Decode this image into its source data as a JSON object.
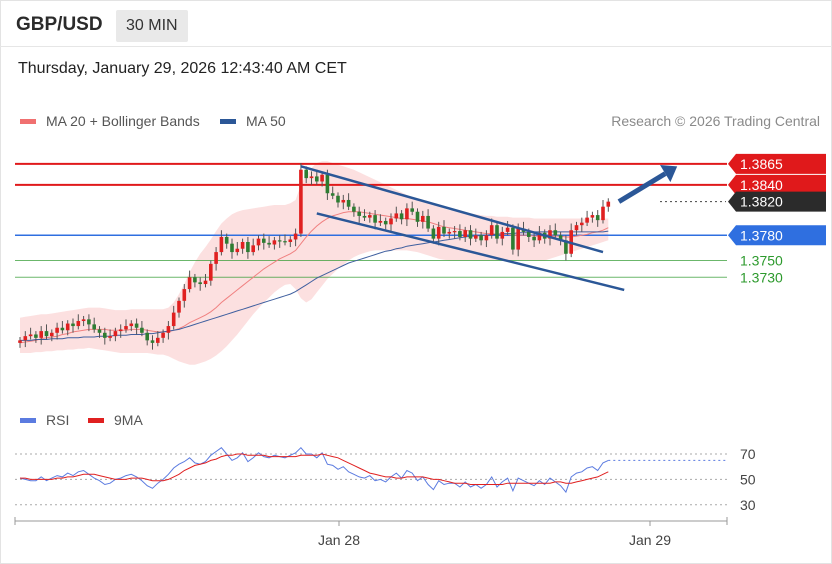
{
  "header": {
    "pair": "GBP/USD",
    "timeframe": "30 MIN",
    "datetime": "Thursday, January 29, 2026 12:43:40 AM CET"
  },
  "legend": {
    "ma_bb": "MA 20 + Bollinger Bands",
    "ma50": "MA 50",
    "rsi": "RSI",
    "rsi_ma": "9MA"
  },
  "credit": "Research © 2026 Trading Central",
  "colors": {
    "resistance": "#e0191b",
    "pivot": "#2f6fe0",
    "support": "#2d9a2d",
    "channel": "#2b5797",
    "bollinger_fill": "#fbd5d5",
    "ma20": "#f08080",
    "ma50": "#3f5f9f",
    "bull": "#e02020",
    "bear": "#2e7d32",
    "current": "#2b2b2b"
  },
  "chart_data": [
    {
      "type": "candlestick",
      "title": "GBP/USD 30 MIN",
      "x_ticks": [
        "Jan 28",
        "Jan 29"
      ],
      "ylim": [
        1.359,
        1.3885
      ],
      "levels": [
        {
          "value": 1.3865,
          "label": "1.3865",
          "kind": "resistance"
        },
        {
          "value": 1.384,
          "label": "1.3840",
          "kind": "resistance"
        },
        {
          "value": 1.382,
          "label": "1.3820",
          "kind": "current"
        },
        {
          "value": 1.378,
          "label": "1.3780",
          "kind": "pivot"
        },
        {
          "value": 1.375,
          "label": "1.3750",
          "kind": "support"
        },
        {
          "value": 1.373,
          "label": "1.3730",
          "kind": "support"
        }
      ],
      "close": [
        1.3655,
        1.366,
        1.3662,
        1.3658,
        1.3666,
        1.366,
        1.3664,
        1.367,
        1.3667,
        1.3675,
        1.3672,
        1.3678,
        1.368,
        1.3674,
        1.3668,
        1.3664,
        1.3658,
        1.366,
        1.3666,
        1.3668,
        1.3672,
        1.3675,
        1.367,
        1.3664,
        1.3655,
        1.3652,
        1.3658,
        1.3664,
        1.3672,
        1.3688,
        1.3702,
        1.3716,
        1.373,
        1.3724,
        1.3722,
        1.3726,
        1.3746,
        1.376,
        1.3778,
        1.377,
        1.376,
        1.3764,
        1.3772,
        1.376,
        1.3768,
        1.3776,
        1.3771,
        1.3769,
        1.3774,
        1.3773,
        1.3772,
        1.3775,
        1.3782,
        1.3858,
        1.3848,
        1.385,
        1.3844,
        1.3852,
        1.383,
        1.3827,
        1.3819,
        1.3822,
        1.3814,
        1.3808,
        1.3803,
        1.3801,
        1.3804,
        1.3795,
        1.3797,
        1.3793,
        1.38,
        1.3806,
        1.3799,
        1.3812,
        1.3808,
        1.3796,
        1.3803,
        1.3788,
        1.3776,
        1.379,
        1.3782,
        1.3784,
        1.3785,
        1.3778,
        1.3786,
        1.3776,
        1.378,
        1.3774,
        1.378,
        1.3792,
        1.3776,
        1.3784,
        1.3789,
        1.3763,
        1.3788,
        1.3784,
        1.3778,
        1.3774,
        1.3783,
        1.3776,
        1.3786,
        1.378,
        1.3774,
        1.3758,
        1.3786,
        1.3792,
        1.3795,
        1.3801,
        1.3804,
        1.3798,
        1.3814,
        1.382
      ],
      "ma20": [
        1.3652,
        1.3653,
        1.3654,
        1.3655,
        1.3657,
        1.3658,
        1.3659,
        1.366,
        1.3662,
        1.3663,
        1.3665,
        1.3666,
        1.3667,
        1.3668,
        1.3668,
        1.3668,
        1.3668,
        1.3667,
        1.3667,
        1.3667,
        1.3667,
        1.3668,
        1.3668,
        1.3668,
        1.3667,
        1.3666,
        1.3665,
        1.3665,
        1.3665,
        1.3667,
        1.3669,
        1.3672,
        1.3676,
        1.3679,
        1.3682,
        1.3685,
        1.3689,
        1.3694,
        1.37,
        1.3705,
        1.371,
        1.3715,
        1.372,
        1.3725,
        1.373,
        1.3735,
        1.374,
        1.3744,
        1.3748,
        1.3752,
        1.3755,
        1.3758,
        1.3762,
        1.377,
        1.3778,
        1.3785,
        1.3791,
        1.3796,
        1.38,
        1.3803,
        1.3805,
        1.3807,
        1.3808,
        1.3808,
        1.3808,
        1.3807,
        1.3806,
        1.3805,
        1.3804,
        1.3803,
        1.3802,
        1.3801,
        1.38,
        1.38,
        1.3799,
        1.3798,
        1.3797,
        1.3796,
        1.3794,
        1.3792,
        1.379,
        1.3789,
        1.3788,
        1.3787,
        1.3786,
        1.3785,
        1.3784,
        1.3783,
        1.3782,
        1.3782,
        1.3781,
        1.3781,
        1.3781,
        1.378,
        1.378,
        1.378,
        1.378,
        1.3779,
        1.3779,
        1.3779,
        1.3779,
        1.3779,
        1.3779,
        1.3778,
        1.3778,
        1.3779,
        1.378,
        1.3781,
        1.3783,
        1.3784,
        1.3786,
        1.3789
      ],
      "ma50": [
        1.3655,
        1.3655,
        1.3655,
        1.3656,
        1.3656,
        1.3656,
        1.3657,
        1.3657,
        1.3657,
        1.3658,
        1.3658,
        1.3658,
        1.3659,
        1.3659,
        1.3659,
        1.366,
        1.366,
        1.366,
        1.3661,
        1.3661,
        1.3661,
        1.3662,
        1.3662,
        1.3662,
        1.3663,
        1.3663,
        1.3664,
        1.3665,
        1.3666,
        1.3667,
        1.3668,
        1.367,
        1.3672,
        1.3674,
        1.3676,
        1.3678,
        1.368,
        1.3682,
        1.3684,
        1.3686,
        1.3688,
        1.369,
        1.3692,
        1.3694,
        1.3696,
        1.3698,
        1.37,
        1.3702,
        1.3704,
        1.3706,
        1.3708,
        1.371,
        1.3713,
        1.3717,
        1.3721,
        1.3725,
        1.3729,
        1.3732,
        1.3735,
        1.3738,
        1.3741,
        1.3744,
        1.3747,
        1.3749,
        1.3751,
        1.3753,
        1.3755,
        1.3757,
        1.3759,
        1.3761,
        1.3762,
        1.3764,
        1.3765,
        1.3767,
        1.3768,
        1.3769,
        1.377,
        1.3771,
        1.3772,
        1.3773,
        1.3774,
        1.3775,
        1.3776,
        1.3777,
        1.3778,
        1.3779,
        1.3779,
        1.378,
        1.378,
        1.3781,
        1.3781,
        1.3782,
        1.3782,
        1.3782,
        1.3783,
        1.3783,
        1.3783,
        1.3784,
        1.3784,
        1.3784,
        1.3784,
        1.3784,
        1.3784,
        1.3784,
        1.3784,
        1.3784,
        1.3784,
        1.3784,
        1.3784,
        1.3784,
        1.3784,
        1.3785
      ],
      "bb_upper": [
        1.3682,
        1.3683,
        1.3684,
        1.3685,
        1.3686,
        1.3686,
        1.3687,
        1.3688,
        1.3689,
        1.369,
        1.3691,
        1.3692,
        1.3693,
        1.3694,
        1.3694,
        1.3694,
        1.3693,
        1.3692,
        1.3691,
        1.3691,
        1.3691,
        1.3692,
        1.3692,
        1.3692,
        1.3692,
        1.3692,
        1.3692,
        1.3692,
        1.3694,
        1.37,
        1.371,
        1.3722,
        1.3736,
        1.3748,
        1.3758,
        1.3766,
        1.3775,
        1.3785,
        1.3794,
        1.38,
        1.3805,
        1.3808,
        1.381,
        1.3811,
        1.3812,
        1.3813,
        1.3814,
        1.3815,
        1.3816,
        1.3816,
        1.3816,
        1.3818,
        1.3822,
        1.384,
        1.3852,
        1.386,
        1.3866,
        1.3868,
        1.3868,
        1.3866,
        1.3864,
        1.3862,
        1.386,
        1.3858,
        1.3855,
        1.3852,
        1.3849,
        1.3846,
        1.3843,
        1.384,
        1.3837,
        1.3834,
        1.3831,
        1.3828,
        1.3825,
        1.3822,
        1.382,
        1.3818,
        1.3816,
        1.3814,
        1.3812,
        1.381,
        1.3809,
        1.3808,
        1.3807,
        1.3806,
        1.3805,
        1.3804,
        1.3803,
        1.3803,
        1.3802,
        1.3802,
        1.3802,
        1.3801,
        1.3801,
        1.3801,
        1.3801,
        1.38,
        1.38,
        1.38,
        1.38,
        1.38,
        1.38,
        1.38,
        1.38,
        1.38,
        1.38,
        1.38,
        1.38,
        1.38,
        1.38,
        1.38
      ],
      "bb_lower": [
        1.364,
        1.364,
        1.364,
        1.3641,
        1.3641,
        1.3642,
        1.3642,
        1.3643,
        1.3643,
        1.3644,
        1.3644,
        1.3645,
        1.3645,
        1.3646,
        1.3645,
        1.3644,
        1.3643,
        1.3642,
        1.3641,
        1.364,
        1.364,
        1.364,
        1.364,
        1.364,
        1.364,
        1.3639,
        1.3638,
        1.3638,
        1.3636,
        1.3633,
        1.363,
        1.3628,
        1.3626,
        1.3626,
        1.3628,
        1.363,
        1.3633,
        1.3637,
        1.3642,
        1.3648,
        1.3655,
        1.3662,
        1.367,
        1.3678,
        1.3686,
        1.3693,
        1.37,
        1.3706,
        1.3712,
        1.3717,
        1.3721,
        1.3722,
        1.3716,
        1.3705,
        1.37,
        1.3704,
        1.3712,
        1.372,
        1.3728,
        1.3734,
        1.374,
        1.3745,
        1.375,
        1.3754,
        1.3757,
        1.3759,
        1.3761,
        1.3762,
        1.3762,
        1.3762,
        1.3762,
        1.3762,
        1.3762,
        1.3762,
        1.3761,
        1.376,
        1.3758,
        1.3756,
        1.3754,
        1.3752,
        1.3751,
        1.375,
        1.375,
        1.375,
        1.375,
        1.375,
        1.375,
        1.375,
        1.375,
        1.375,
        1.375,
        1.375,
        1.375,
        1.375,
        1.375,
        1.375,
        1.375,
        1.375,
        1.375,
        1.375,
        1.3752,
        1.3754,
        1.3756,
        1.3758,
        1.376,
        1.3762,
        1.3764,
        1.3766,
        1.3768,
        1.377,
        1.3772,
        1.3774
      ],
      "channel_upper": [
        {
          "bar": 53,
          "value": 1.3862
        },
        {
          "bar": 110,
          "value": 1.376
        }
      ],
      "channel_lower": [
        {
          "bar": 56,
          "value": 1.3806
        },
        {
          "bar": 114,
          "value": 1.3715
        }
      ],
      "arrow": [
        {
          "bar": 113,
          "value": 1.382
        },
        {
          "bar": 124,
          "value": 1.3862
        }
      ]
    },
    {
      "type": "line",
      "title": "RSI",
      "y_ticks": [
        70,
        50,
        30
      ],
      "ylim": [
        18,
        85
      ],
      "series": [
        {
          "name": "RSI",
          "values": [
            51,
            50,
            49,
            49,
            52,
            49,
            51,
            53,
            52,
            55,
            53,
            56,
            57,
            54,
            51,
            49,
            46,
            47,
            50,
            51,
            53,
            54,
            52,
            49,
            45,
            43,
            47,
            50,
            54,
            59,
            62,
            64,
            67,
            63,
            62,
            64,
            69,
            72,
            75,
            70,
            65,
            67,
            71,
            64,
            67,
            71,
            68,
            67,
            69,
            68,
            67,
            69,
            71,
            75,
            70,
            70,
            67,
            71,
            62,
            61,
            58,
            60,
            56,
            54,
            52,
            51,
            53,
            49,
            50,
            48,
            52,
            55,
            51,
            57,
            55,
            49,
            52,
            46,
            42,
            49,
            46,
            47,
            47,
            44,
            48,
            44,
            46,
            43,
            46,
            52,
            44,
            48,
            51,
            41,
            51,
            49,
            47,
            45,
            49,
            46,
            51,
            48,
            45,
            40,
            52,
            55,
            56,
            59,
            60,
            57,
            63,
            65
          ]
        },
        {
          "name": "9MA",
          "values": [
            51,
            51,
            50,
            50,
            50,
            50,
            50,
            51,
            51,
            52,
            52,
            53,
            54,
            54,
            54,
            53,
            52,
            51,
            50,
            50,
            50,
            51,
            51,
            51,
            50,
            49,
            49,
            49,
            50,
            52,
            54,
            57,
            59,
            61,
            62,
            63,
            65,
            66,
            68,
            69,
            69,
            70,
            70,
            69,
            69,
            69,
            69,
            68,
            68,
            68,
            68,
            68,
            68,
            69,
            69,
            69,
            69,
            70,
            69,
            68,
            67,
            65,
            63,
            61,
            59,
            57,
            55,
            54,
            53,
            52,
            52,
            51,
            51,
            52,
            52,
            52,
            52,
            51,
            50,
            50,
            49,
            48,
            47,
            47,
            47,
            46,
            46,
            46,
            46,
            46,
            46,
            46,
            47,
            47,
            47,
            47,
            47,
            47,
            47,
            47,
            47,
            48,
            48,
            47,
            47,
            48,
            49,
            50,
            51,
            52,
            54,
            56
          ]
        }
      ]
    }
  ]
}
